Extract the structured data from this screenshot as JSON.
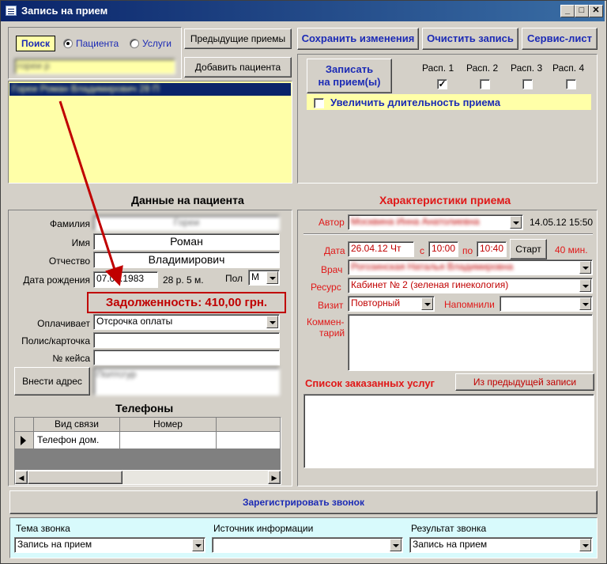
{
  "window": {
    "title": "Запись на прием"
  },
  "search": {
    "label": "Поиск",
    "radio_patients": "Пациента",
    "radio_services": "Услуги",
    "query": "гореи р",
    "result_row": "Гореи Роман Владимирович 28 П"
  },
  "buttons": {
    "previous_visits": "Предыдущие приемы",
    "add_patient": "Добавить пациента",
    "save_changes": "Сохранить изменения",
    "clear_record": "Очистить запись",
    "service_sheet": "Сервис-лист",
    "book_visit_line1": "Записать",
    "book_visit_line2": "на прием(ы)",
    "add_address": "Внести адрес",
    "start": "Старт",
    "from_previous": "Из предыдущей записи",
    "register_call": "Зарегистрировать звонок"
  },
  "schedules": [
    {
      "label": "Расп. 1",
      "checked": true,
      "mark": "✓"
    },
    {
      "label": "Расп. 2",
      "checked": false,
      "mark": ""
    },
    {
      "label": "Расп. 3",
      "checked": false,
      "mark": ""
    },
    {
      "label": "Расп. 4",
      "checked": false,
      "mark": ""
    }
  ],
  "extend_duration": "Увеличить длительность приема",
  "patient": {
    "section_title": "Данные на пациента",
    "surname_label": "Фамилия",
    "surname": "Гореи",
    "name_label": "Имя",
    "name": "Роман",
    "patronymic_label": "Отчество",
    "patronymic": "Владимирович",
    "dob_label": "Дата рождения",
    "dob": "07.05.1983",
    "age": "28 р. 5 м.",
    "sex_label": "Пол",
    "sex": "М",
    "debt": "Задолженность: 410,00 грн.",
    "payer_label": "Оплачивает",
    "payer": "Отсрочка оплаты",
    "policy_label": "Полис/карточка",
    "policy": "",
    "case_label": "№ кейса",
    "case": "",
    "address": "Полтсгур"
  },
  "phones": {
    "title": "Телефоны",
    "columns": [
      "Вид связи",
      "Номер"
    ],
    "rows": [
      {
        "type": "Телефон дом.",
        "number": ""
      }
    ]
  },
  "visit": {
    "section_title": "Характеристики приема",
    "author_label": "Автор",
    "author": "Москвина Инна Анатолиевна",
    "created": "14.05.12 15:50",
    "date_label": "Дата",
    "date": "26.04.12 Чт",
    "from_label": "с",
    "time_from": "10:00",
    "to_label": "по",
    "time_to": "10:40",
    "duration": "40 мин.",
    "doctor_label": "Врач",
    "doctor": "Рогозинская Наталья Владимировна",
    "resource_label": "Ресурс",
    "resource": "Кабинет № 2 (зеленая гинекология)",
    "visit_label": "Визит",
    "visit_type": "Повторный",
    "reminded_label": "Напомнили",
    "reminded": "",
    "comment_label_1": "Коммен-",
    "comment_label_2": "тарий",
    "services_title": "Список заказанных услуг"
  },
  "call": {
    "topic_label": "Тема звонка",
    "topic": "Запись на прием",
    "source_label": "Источник информации",
    "source": "",
    "result_label": "Результат звонка",
    "result": "Запись на прием"
  },
  "colors": {
    "accent_blue": "#1c2bb5",
    "label_red": "#e01818",
    "highlight_yellow": "#ffffa8",
    "arrow": "#c00000"
  }
}
